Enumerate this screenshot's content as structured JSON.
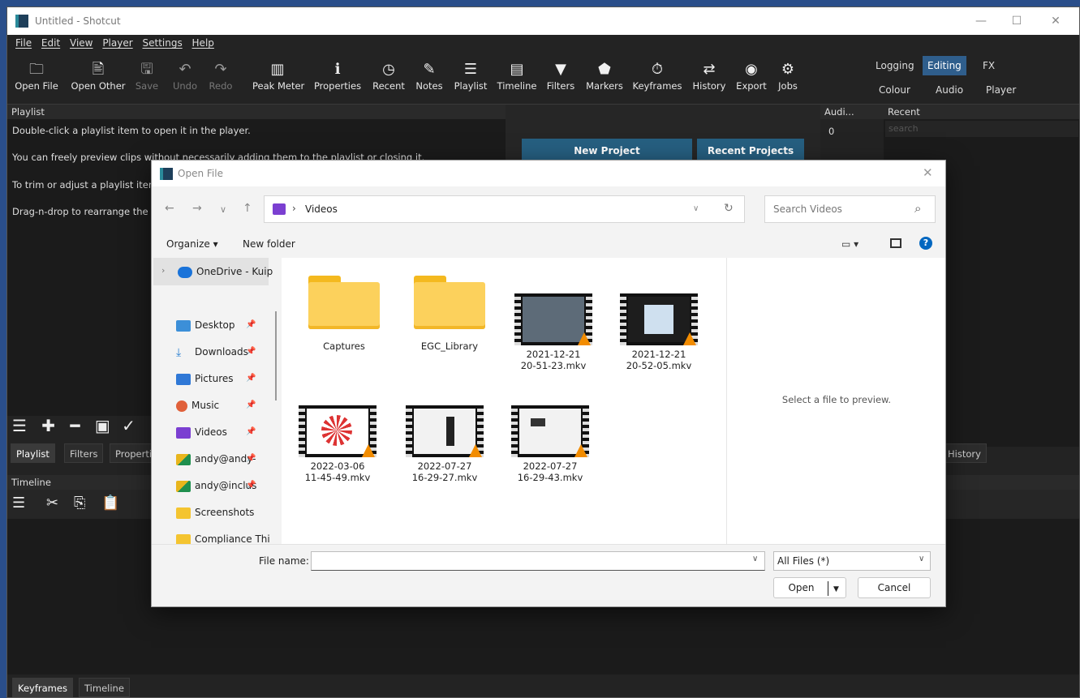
{
  "window": {
    "title": "Untitled - Shotcut",
    "controls": {
      "minimize": "—",
      "maximize": "☐",
      "close": "✕"
    }
  },
  "menu": [
    "File",
    "Edit",
    "View",
    "Player",
    "Settings",
    "Help"
  ],
  "toolbar": [
    {
      "label": "Open File",
      "icon": "folder-icon",
      "glyph": "🗀",
      "enabled": true
    },
    {
      "label": "Open Other",
      "icon": "open-other-icon",
      "glyph": "🖹",
      "enabled": true
    },
    {
      "label": "Save",
      "icon": "save-icon",
      "glyph": "🖫",
      "enabled": false
    },
    {
      "label": "Undo",
      "icon": "undo-icon",
      "glyph": "↶",
      "enabled": false
    },
    {
      "label": "Redo",
      "icon": "redo-icon",
      "glyph": "↷",
      "enabled": false
    },
    {
      "label": "Peak Meter",
      "icon": "peak-meter-icon",
      "glyph": "▥",
      "enabled": true
    },
    {
      "label": "Properties",
      "icon": "info-icon",
      "glyph": "ℹ",
      "enabled": true
    },
    {
      "label": "Recent",
      "icon": "clock-icon",
      "glyph": "◷",
      "enabled": true
    },
    {
      "label": "Notes",
      "icon": "notes-icon",
      "glyph": "✎",
      "enabled": true
    },
    {
      "label": "Playlist",
      "icon": "list-icon",
      "glyph": "☰",
      "enabled": true
    },
    {
      "label": "Timeline",
      "icon": "timeline-icon",
      "glyph": "▤",
      "enabled": true
    },
    {
      "label": "Filters",
      "icon": "filter-icon",
      "glyph": "▼",
      "enabled": true
    },
    {
      "label": "Markers",
      "icon": "marker-icon",
      "glyph": "⬟",
      "enabled": true
    },
    {
      "label": "Keyframes",
      "icon": "stopwatch-icon",
      "glyph": "⏱",
      "enabled": true
    },
    {
      "label": "History",
      "icon": "history-icon",
      "glyph": "⇄",
      "enabled": true
    },
    {
      "label": "Export",
      "icon": "export-icon",
      "glyph": "◉",
      "enabled": true
    },
    {
      "label": "Jobs",
      "icon": "gear-icon",
      "glyph": "⚙",
      "enabled": true
    }
  ],
  "layouts": {
    "row1": [
      "Logging",
      "Editing",
      "FX"
    ],
    "row2": [
      "Colour",
      "Audio",
      "Player"
    ],
    "active": "Editing"
  },
  "playlist": {
    "header": "Playlist",
    "lines": [
      "Double-click a playlist item to open it in the player.",
      "You can freely preview clips without necessarily adding them to the playlist or closing it.",
      "To trim or adjust a playlist item",
      "Drag-n-drop to rearrange the it"
    ],
    "tabs": [
      "Playlist",
      "Filters",
      "Properti"
    ]
  },
  "audio_panel": {
    "header": "Audi...",
    "value": "0"
  },
  "recent_panel": {
    "header": "Recent",
    "search_placeholder": "search"
  },
  "project_buttons": {
    "new": "New Project",
    "recent": "Recent Projects"
  },
  "history_tab": "History",
  "timeline": {
    "header": "Timeline"
  },
  "bottom_tabs": [
    "Keyframes",
    "Timeline"
  ],
  "dialog": {
    "title": "Open File",
    "close": "✕",
    "nav": {
      "back": "←",
      "forward": "→",
      "recent": "∨",
      "up": "↑"
    },
    "address": {
      "separator": "›",
      "location": "Videos",
      "dropdown": "∨",
      "refresh": "↻"
    },
    "search_placeholder": "Search Videos",
    "search_icon": "⌕",
    "organize": "Organize ▾",
    "new_folder": "New folder",
    "view_icon": "▭ ▾",
    "navpane": [
      {
        "label": "OneDrive - Kuip",
        "icon": "onedrive-icon",
        "color": "#1a73d9",
        "pinned": false
      },
      {
        "label": "Desktop",
        "icon": "desktop-icon",
        "color": "#3c8fd8",
        "pinned": true
      },
      {
        "label": "Downloads",
        "icon": "download-icon",
        "color": "#2a7fd0",
        "pinned": true
      },
      {
        "label": "Pictures",
        "icon": "pictures-icon",
        "color": "#2f78d6",
        "pinned": true
      },
      {
        "label": "Music",
        "icon": "music-icon",
        "color": "#e0603a",
        "pinned": true
      },
      {
        "label": "Videos",
        "icon": "videos-icon",
        "color": "#7b3fd1",
        "pinned": true
      },
      {
        "label": "andy@andy-",
        "icon": "drive-icon",
        "color": "#e8b51c",
        "pinned": true
      },
      {
        "label": "andy@inclus",
        "icon": "drive-icon",
        "color": "#e8b51c",
        "pinned": true
      },
      {
        "label": "Screenshots",
        "icon": "folder-icon",
        "color": "#f4c430",
        "pinned": false
      },
      {
        "label": "Compliance Thi",
        "icon": "folder-icon",
        "color": "#f4c430",
        "pinned": false
      }
    ],
    "files": [
      {
        "name": "Captures",
        "kind": "folder"
      },
      {
        "name": "EGC_Library",
        "kind": "folder"
      },
      {
        "name": "2021-12-21\n20-51-23.mkv",
        "kind": "video"
      },
      {
        "name": "2021-12-21\n20-52-05.mkv",
        "kind": "video"
      },
      {
        "name": "2022-03-06\n11-45-49.mkv",
        "kind": "video"
      },
      {
        "name": "2022-07-27\n16-29-27.mkv",
        "kind": "video"
      },
      {
        "name": "2022-07-27\n16-29-43.mkv",
        "kind": "video"
      }
    ],
    "preview_text": "Select a file to preview.",
    "filename_label": "File name:",
    "filename_value": "",
    "filter": "All Files (*)",
    "open": "Open",
    "cancel": "Cancel",
    "colors": {
      "accent": "#0067c0",
      "folder": "#fcd15c"
    }
  }
}
